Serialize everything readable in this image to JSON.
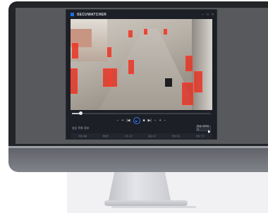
{
  "app": {
    "title": "SECUWATCHER",
    "window_controls": [
      "−",
      "□",
      "×"
    ]
  },
  "player": {
    "progress_fraction": 0.06,
    "controls": [
      "−",
      "+",
      "|◀",
      "▶",
      "■",
      "▶|",
      "−",
      "+",
      "−"
    ]
  },
  "info": {
    "label": "영상 목록 정보",
    "button_label": "영상 내보내기",
    "columns": [
      "파일 이름",
      "채널명",
      "시작 시간",
      "종료시간",
      "촬영 장소",
      "파일 크기"
    ]
  },
  "colors": {
    "accent": "#1a6fe8",
    "detection_box": "#ff3b2a"
  }
}
